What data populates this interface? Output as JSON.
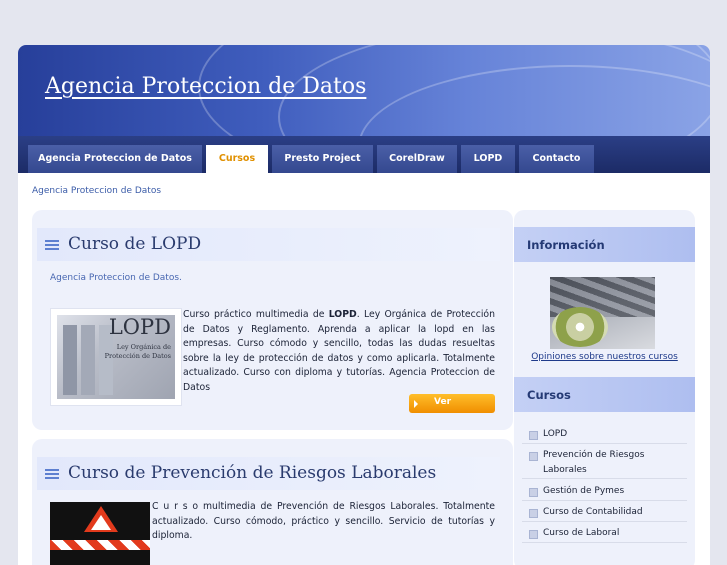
{
  "site": {
    "title": "Agencia Proteccion de Datos"
  },
  "nav": {
    "tabs": [
      {
        "label": "Agencia Proteccion de Datos"
      },
      {
        "label": "Cursos"
      },
      {
        "label": "Presto Project"
      },
      {
        "label": "CorelDraw"
      },
      {
        "label": "LOPD"
      },
      {
        "label": "Contacto"
      }
    ]
  },
  "breadcrumb": "Agencia Proteccion de Datos",
  "articles": [
    {
      "title": "Curso de LOPD",
      "subtitle": "Agencia Proteccion de Datos.",
      "description_prefix": "Curso práctico multimedia de ",
      "description_bold": "LOPD",
      "description_rest": ". Ley Orgánica de Protección de Datos y Reglamento. Aprenda a aplicar la lopd en las empresas. Curso cómodo y sencillo, todas las dudas resueltas sobre la ley de protección de datos y como aplicarla. Totalmente actualizado. Curso con diploma y tutorías. Agencia Proteccion de Datos",
      "button_label": "Ver",
      "image_text": {
        "big": "LOPD",
        "line1": "Ley Orgánica de",
        "line2": "Protección de Datos"
      }
    },
    {
      "title": "Curso de Prevención de Riesgos Laborales",
      "description": "C u r s o multimedia de Prevención de Riesgos Laborales. Totalmente actualizado. Curso cómodo, práctico y sencillo. Servicio de tutorías y diploma."
    }
  ],
  "sidebar": {
    "info_heading": "Información",
    "info_link": "Opiniones sobre nuestros cursos",
    "cursos_heading": "Cursos",
    "cursos": [
      {
        "label": "LOPD"
      },
      {
        "label": "Prevención de Riesgos Laborales"
      },
      {
        "label": "Gestión de Pymes"
      },
      {
        "label": "Curso de Contabilidad"
      },
      {
        "label": "Curso de Laboral"
      }
    ]
  },
  "colors": {
    "header_dark": "#273f9a",
    "nav": "#1c2b66",
    "active_tab_text": "#e09000",
    "button": "#f5a000",
    "link": "#3b5ca8"
  }
}
